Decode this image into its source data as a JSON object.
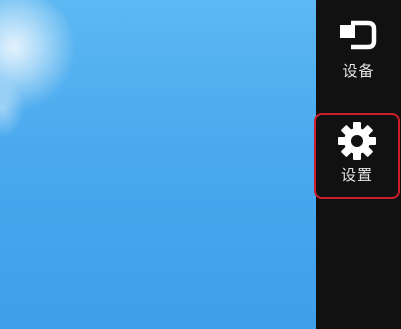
{
  "charms": {
    "devices": {
      "label": "设备",
      "icon": "devices-icon"
    },
    "settings": {
      "label": "设置",
      "icon": "gear-icon",
      "highlighted": true
    }
  },
  "colors": {
    "desktop": "#4aa9ee",
    "charms_bar": "#111111",
    "highlight": "#cc1f2a",
    "label": "#e6e6e6"
  }
}
